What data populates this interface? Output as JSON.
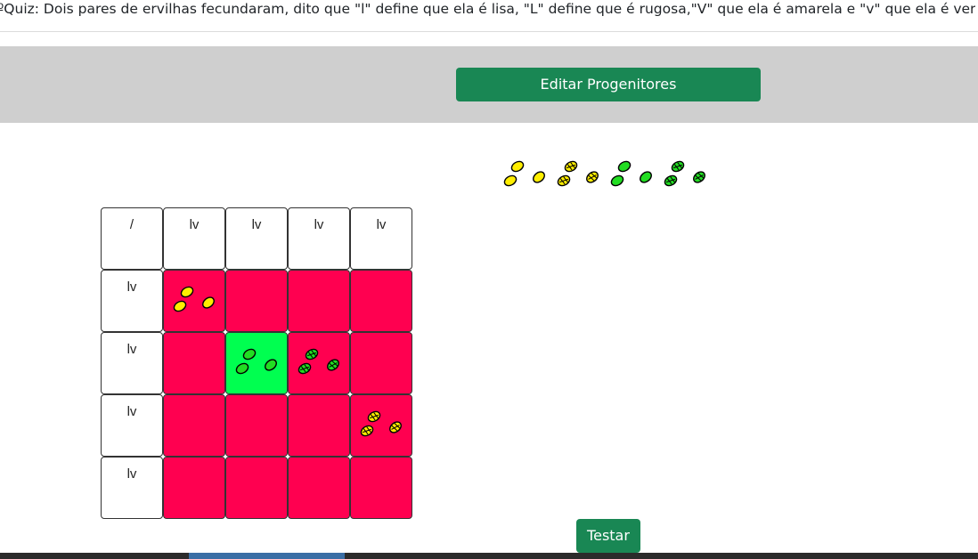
{
  "quiz": {
    "title": "ºQuiz: Dois pares de ervilhas fecundaram, dito que \"l\" define que ela é lisa, \"L\" define que é rugosa,\"V\" que ela é amarela e \"v\" que ela é verde, sendo"
  },
  "toolbar": {
    "edit_label": "Editar Progenitores"
  },
  "actions": {
    "test_label": "Testar"
  },
  "punnett": {
    "corner": "/",
    "column_headers": [
      "lv",
      "lv",
      "lv",
      "lv"
    ],
    "row_headers": [
      "lv",
      "lv",
      "lv",
      "lv"
    ],
    "cells": [
      [
        {
          "state": "wrong",
          "peas": "yellow-smooth"
        },
        {
          "state": "wrong",
          "peas": ""
        },
        {
          "state": "wrong",
          "peas": ""
        },
        {
          "state": "wrong",
          "peas": ""
        }
      ],
      [
        {
          "state": "wrong",
          "peas": ""
        },
        {
          "state": "correct",
          "peas": "green-smooth"
        },
        {
          "state": "wrong",
          "peas": "green-wrinkled"
        },
        {
          "state": "wrong",
          "peas": ""
        }
      ],
      [
        {
          "state": "wrong",
          "peas": ""
        },
        {
          "state": "wrong",
          "peas": ""
        },
        {
          "state": "wrong",
          "peas": ""
        },
        {
          "state": "wrong",
          "peas": "yellow-wrinkled"
        }
      ],
      [
        {
          "state": "wrong",
          "peas": ""
        },
        {
          "state": "wrong",
          "peas": ""
        },
        {
          "state": "wrong",
          "peas": ""
        },
        {
          "state": "wrong",
          "peas": ""
        }
      ]
    ]
  },
  "parents": {
    "pea_types": [
      "yellow-smooth",
      "yellow-wrinkled",
      "green-smooth",
      "green-wrinkled"
    ]
  },
  "colors": {
    "wrong": "#ff0050",
    "correct": "#00ff50",
    "button": "#198754",
    "toolbar": "#cfcfcf",
    "pea_yellow": "#ffee00",
    "pea_green": "#22dd22"
  }
}
